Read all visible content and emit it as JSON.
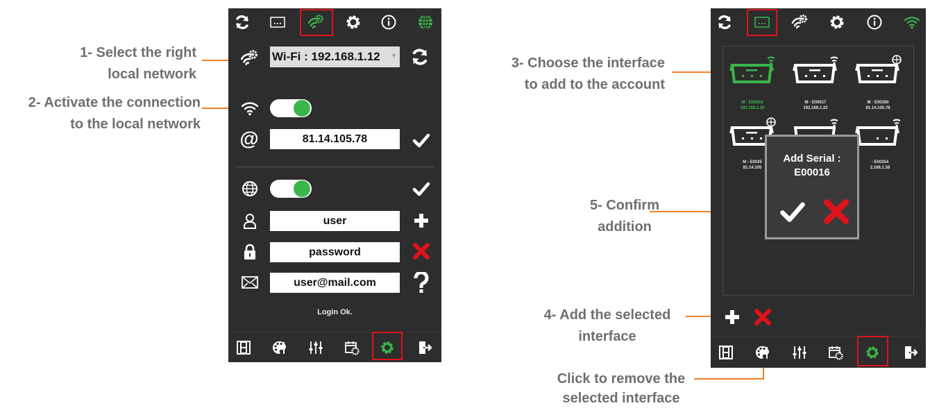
{
  "annotations": {
    "step1_line1": "1- Select the right",
    "step1_line2": "local network",
    "step2_line1": "2- Activate the connection",
    "step2_line2": "to the local network",
    "step3_line1": "3- Choose the interface",
    "step3_line2": "to add to the account",
    "step4_line1": "4- Add the selected",
    "step4_line2": "interface",
    "step5_line1": "5- Confirm",
    "step5_line2": "addition",
    "remove_line1": "Click to remove the",
    "remove_line2": "selected interface"
  },
  "colors": {
    "accent": "#3bb54a",
    "highlight": "#e0121a",
    "panel": "#2d2d2d",
    "annotation": "#6f6f6f",
    "leader": "#f0812a"
  },
  "network_panel": {
    "top_icons": [
      "refresh-icon",
      "screen-icon",
      "wifi-gear-icon",
      "gear-icon",
      "info-icon",
      "globe-icon"
    ],
    "network_select": "Wi-Fi : 192.168.1.12",
    "ip_address": "81.14.105.78",
    "username": "user",
    "password": "password",
    "email": "user@mail.com",
    "status": "Login Ok.",
    "bottom_icons": [
      "film-icon",
      "palette-icon",
      "sliders-icon",
      "calendar-gear-icon",
      "gear-icon",
      "exit-icon"
    ]
  },
  "devices_panel": {
    "devices": [
      {
        "name": "M - E00016",
        "ip": "192.168.1.20",
        "selected": true,
        "link": "wifi"
      },
      {
        "name": "M - E00017",
        "ip": "192.168.1.22",
        "selected": false,
        "link": "wifi"
      },
      {
        "name": "M - E00350",
        "ip": "81.14.105.78",
        "selected": false,
        "link": "globe"
      },
      {
        "name": "M - E0035",
        "ip": "81.14.105",
        "selected": false,
        "link": "globe"
      },
      {
        "name": "",
        "ip": "",
        "selected": false,
        "link": "wifi"
      },
      {
        "name": "- E00354",
        "ip": "2.168.1.38",
        "selected": false,
        "link": "wifi"
      }
    ],
    "dialog_title_line1": "Add Serial :",
    "dialog_title_line2": "E00016"
  }
}
